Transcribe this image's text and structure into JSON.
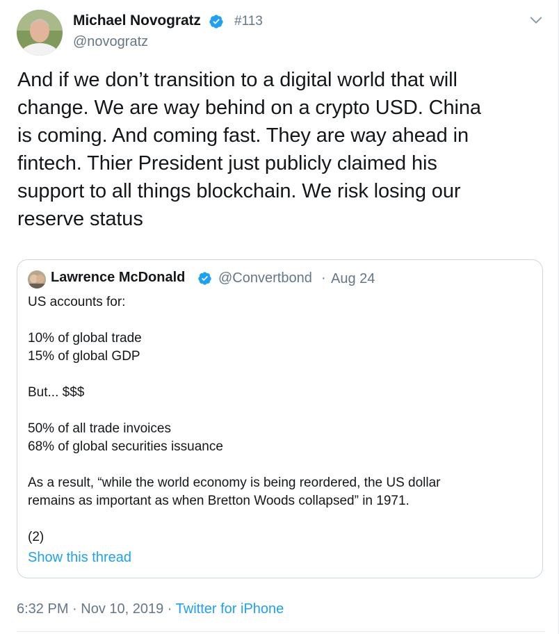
{
  "tweet": {
    "author_name": "Michael Novogratz",
    "tag": "#113",
    "handle": "@novogratz",
    "text": "And if we don’t transition to a digital world that will\nchange.  We are way behind on a crypto USD.  China\nis coming.  And coming fast.  They are way ahead in\nfintech.  Thier President just publicly claimed his\nsupport to all things blockchain.  We risk losing our\nreserve status",
    "icons": {
      "verified": "verified-badge-icon",
      "menu": "chevron-down-icon"
    }
  },
  "quote": {
    "author_name": "Lawrence McDonald",
    "handle": "@Convertbond",
    "separator": "·",
    "date": "Aug 24",
    "text": "US accounts for:\n\n10% of global trade\n15% of global GDP\n\nBut... $$$\n\n50% of all trade invoices\n68% of global securities issuance\n\nAs a result, “while the world economy is being reordered, the US dollar\nremains as important as when Bretton Woods collapsed” in 1971.\n\n(2)",
    "show_thread": "Show this thread"
  },
  "meta": {
    "time": "6:32 PM",
    "sep1": " · ",
    "date": "Nov 10, 2019",
    "sep2": " · ",
    "source": "Twitter for iPhone"
  },
  "colors": {
    "accent": "#1da1f2",
    "secondary_text": "#657786",
    "border": "#ccd6dd"
  }
}
